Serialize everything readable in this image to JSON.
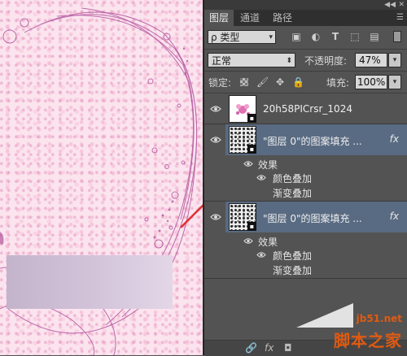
{
  "panel": {
    "tabs": [
      {
        "label": "图层",
        "active": true
      },
      {
        "label": "通道",
        "active": false
      },
      {
        "label": "路径",
        "active": false
      }
    ],
    "filter": {
      "label": "ρ 类型"
    },
    "blend_mode": "正常",
    "opacity_label": "不透明度:",
    "opacity_value": "47%",
    "lock_label": "锁定:",
    "fill_label": "填充:",
    "fill_value": "100%",
    "layers": [
      {
        "name": "20h58PICrsr_1024",
        "type": "image"
      },
      {
        "name": "\"图层 0\"的图案填充 ...",
        "type": "pattern",
        "effects_label": "效果",
        "effects": [
          "颜色叠加",
          "渐变叠加"
        ]
      },
      {
        "name": "\"图层 0\"的图案填充 ...",
        "type": "pattern",
        "effects_label": "效果",
        "effects": [
          "颜色叠加",
          "渐变叠加"
        ]
      }
    ],
    "fx_label": "fx"
  },
  "watermark": {
    "url": "jb51.net",
    "name": "脚本之家"
  },
  "colors": {
    "arrow": "#e03030",
    "panel_bg": "#535353",
    "selected_row": "#596b82",
    "canvas_bg": "#fbe4ee",
    "watermark": "#e05a12"
  },
  "icons": [
    "search-icon",
    "image-filter-icon",
    "adjustment-filter-icon",
    "type-filter-icon",
    "shape-filter-icon",
    "smart-object-filter-icon",
    "eye-icon",
    "brush-icon",
    "move-icon",
    "lock-icon",
    "link-icon",
    "fx-icon"
  ]
}
